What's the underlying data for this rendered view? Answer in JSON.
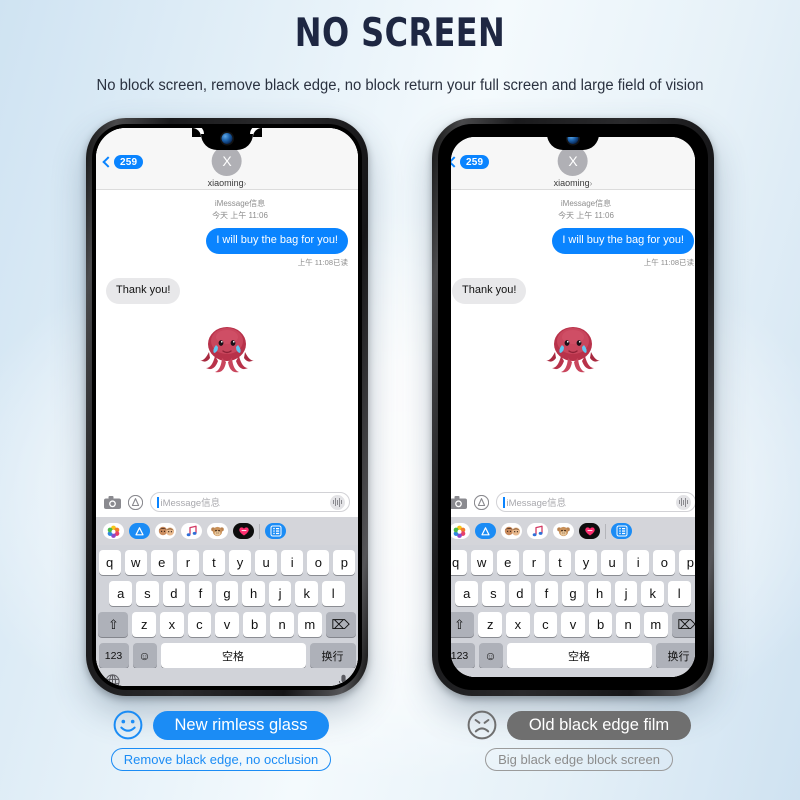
{
  "header": {
    "title": "NO SCREEN",
    "subtitle": "No block screen, remove black edge, no block return your full screen and large field of vision"
  },
  "colors": {
    "title": "#1e2742",
    "accent_blue": "#1b8cf5",
    "bubble_blue": "#0a84ff",
    "bubble_gray": "#e8e8ea",
    "bad_gray": "#6f6f6f",
    "background_blue": "#cfe3f2"
  },
  "screen": {
    "nav": {
      "back_badge": "259",
      "avatar_initial": "X",
      "contact_name": "xiaoming",
      "contact_arrow": "›"
    },
    "conversation": {
      "service_label": "iMessage信息",
      "timestamp": "今天 上午 11:06",
      "messages": [
        {
          "text": "I will buy the bag for you!",
          "side": "out"
        },
        {
          "text": "Thank you!",
          "side": "in"
        }
      ],
      "read_receipt": "上午 11:08已读",
      "sticker": "crying-octopus"
    },
    "input": {
      "camera_icon": "camera-icon",
      "appstore_icon": "app-store-icon",
      "placeholder": "iMessage信息",
      "audio_icon": "audio-waveform-icon"
    },
    "app_strip": [
      {
        "name": "photos-app-icon",
        "glyph": "✿"
      },
      {
        "name": "app-store-app-icon",
        "glyph": "A"
      },
      {
        "name": "memoji-app-icon",
        "glyph": "👫"
      },
      {
        "name": "music-app-icon",
        "glyph": "♫"
      },
      {
        "name": "animoji-app-icon",
        "glyph": "🐵"
      },
      {
        "name": "digital-touch-app-icon",
        "glyph": "♥"
      },
      {
        "name": "more-apps-icon",
        "glyph": "☷"
      }
    ],
    "keyboard": {
      "row1": [
        "q",
        "w",
        "e",
        "r",
        "t",
        "y",
        "u",
        "i",
        "o",
        "p"
      ],
      "row2": [
        "a",
        "s",
        "d",
        "f",
        "g",
        "h",
        "j",
        "k",
        "l"
      ],
      "shift_key": "⇧",
      "row3": [
        "z",
        "x",
        "c",
        "v",
        "b",
        "n",
        "m"
      ],
      "backspace_key": "⌦",
      "numeric_key": "123",
      "emoji_key": "☺",
      "space_key": "空格",
      "return_key": "换行",
      "globe_icon": "globe-icon",
      "mic_icon": "microphone-icon"
    }
  },
  "footers": [
    {
      "face": "smiley-face-icon",
      "label": "New rimless glass",
      "sub": "Remove black edge, no occlusion",
      "variant": "good"
    },
    {
      "face": "sad-face-icon",
      "label": "Old black edge film",
      "sub": "Big black edge block screen",
      "variant": "bad"
    }
  ]
}
